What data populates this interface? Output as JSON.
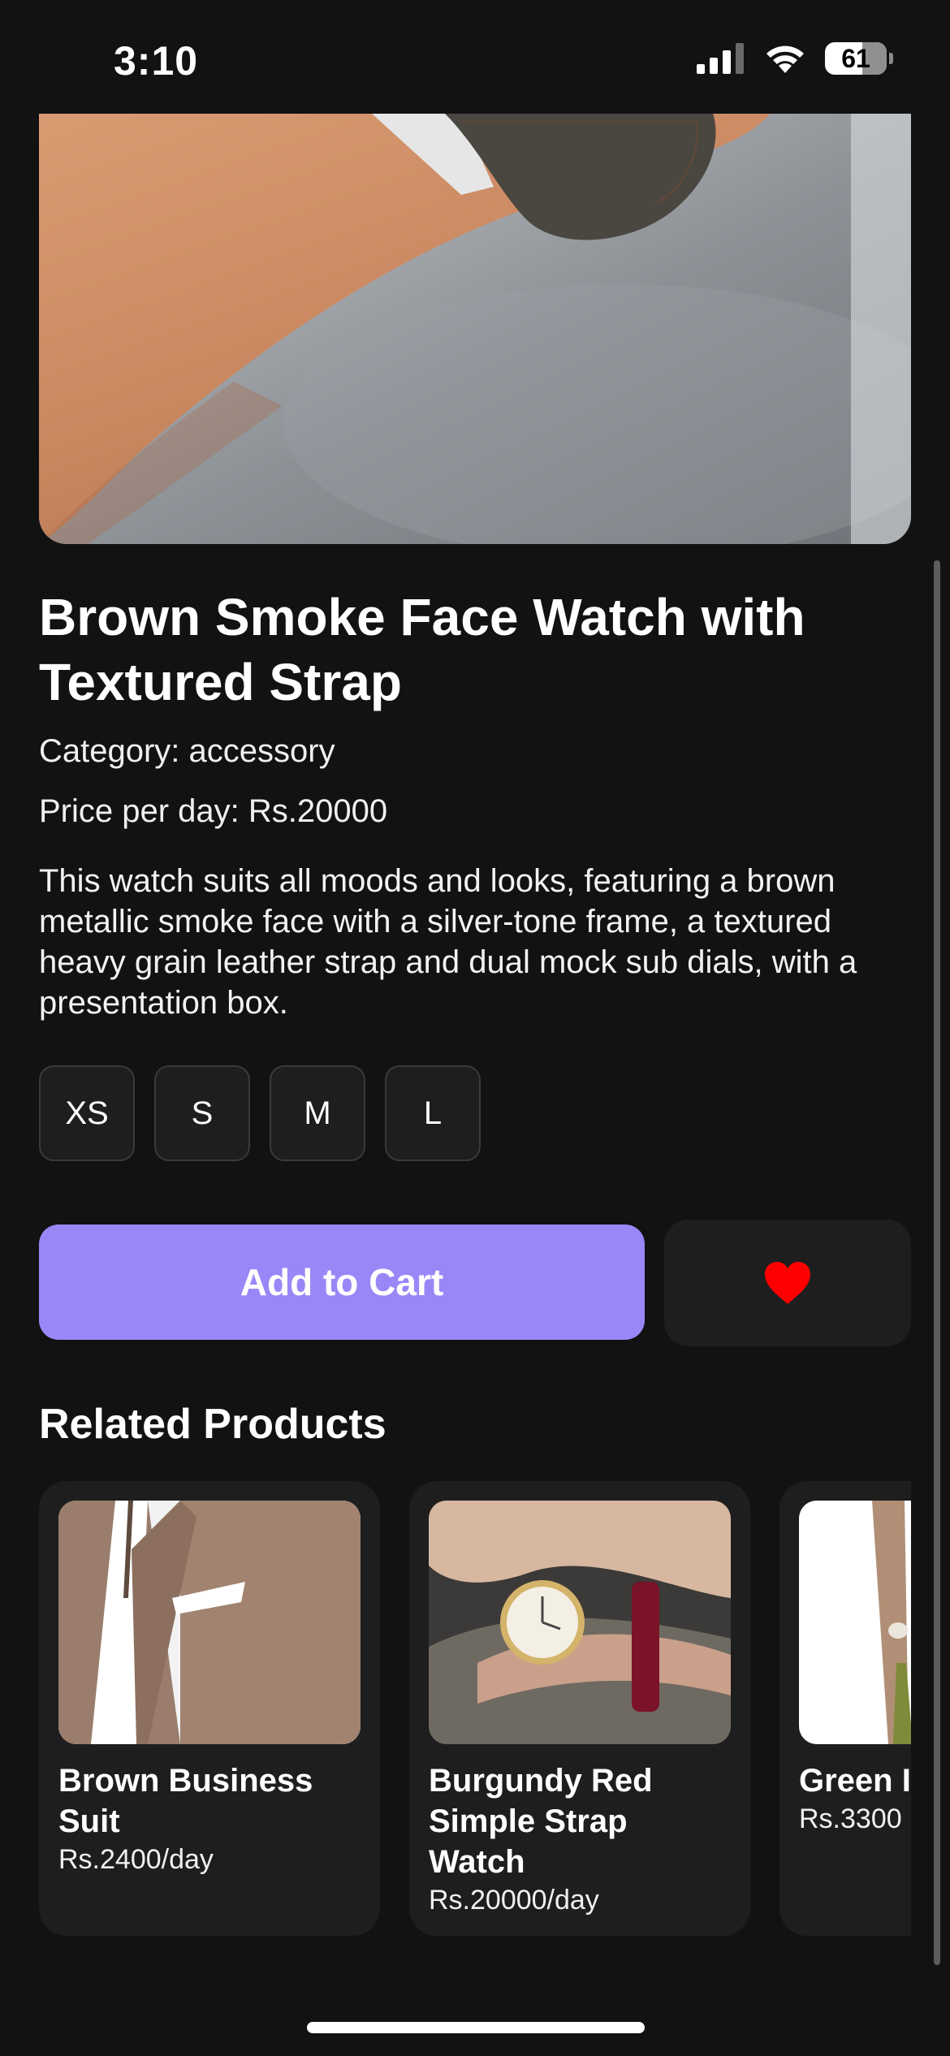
{
  "status_bar": {
    "time": "3:10",
    "battery": "61",
    "battery_level": 0.61
  },
  "product": {
    "title": "Brown Smoke Face Watch with Textured Strap",
    "category": "Category: accessory",
    "price": "Price per day: Rs.20000",
    "description": "This watch suits all moods and looks, featuring a brown metallic smoke face with a silver-tone frame, a textured heavy grain leather strap and dual mock sub dials, with a presentation box.",
    "sizes": [
      "XS",
      "S",
      "M",
      "L"
    ],
    "add_to_cart_label": "Add to Cart"
  },
  "related": {
    "heading": "Related Products",
    "items": [
      {
        "name": "Brown Business Suit",
        "price": "Rs.2400/day"
      },
      {
        "name": "Burgundy Red Simple Strap Watch",
        "price": "Rs.20000/day"
      },
      {
        "name": "Green I",
        "price": "Rs.3300"
      }
    ]
  },
  "colors": {
    "background": "#121212",
    "accent": "#9a87f7",
    "favorite": "#ff0000",
    "surface": "#1e1e1e"
  },
  "icons": {
    "cellular": "cellular-signal-icon",
    "wifi": "wifi-icon",
    "battery": "battery-icon",
    "favorite": "heart-icon"
  }
}
